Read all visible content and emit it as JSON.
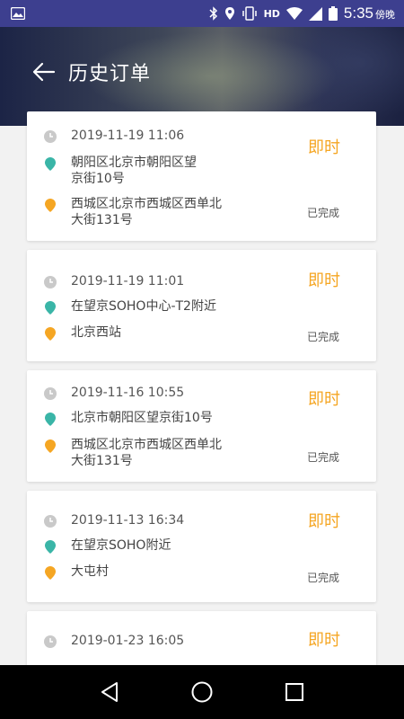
{
  "status_bar": {
    "network_label": "HD",
    "time": "5:35",
    "period": "傍晚",
    "icons": [
      "image-icon",
      "bluetooth-icon",
      "location-icon",
      "vibrate-icon",
      "wifi-icon",
      "signal-icon",
      "battery-icon"
    ]
  },
  "header": {
    "title": "历史订单",
    "back_icon": "back-arrow-icon"
  },
  "colors": {
    "accent_orange": "#f5a623",
    "pickup_teal": "#3ab5a7",
    "dropoff_orange": "#f5a623",
    "header_dark": "#1c2446"
  },
  "orders": [
    {
      "time": "2019-11-19  11:06",
      "type": "即时",
      "from": [
        "朝阳区北京市朝阳区望",
        "京街10号"
      ],
      "to": [
        "西城区北京市西城区西单北",
        "大街131号"
      ],
      "status": "已完成"
    },
    {
      "time": "2019-11-19  11:01",
      "type": "即时",
      "from": [
        "在望京SOHO中心-T2附近"
      ],
      "to": [
        "北京西站"
      ],
      "status": "已完成"
    },
    {
      "time": "2019-11-16  10:55",
      "type": "即时",
      "from": [
        "北京市朝阳区望京街10号"
      ],
      "to": [
        "西城区北京市西城区西单北",
        "大街131号"
      ],
      "status": "已完成"
    },
    {
      "time": "2019-11-13  16:34",
      "type": "即时",
      "from": [
        "在望京SOHO附近"
      ],
      "to": [
        "大屯村"
      ],
      "status": "已完成"
    },
    {
      "time": "2019-01-23  16:05",
      "type": "即时"
    }
  ],
  "nav_bar": [
    "back-triangle-icon",
    "home-circle-icon",
    "recents-square-icon"
  ]
}
